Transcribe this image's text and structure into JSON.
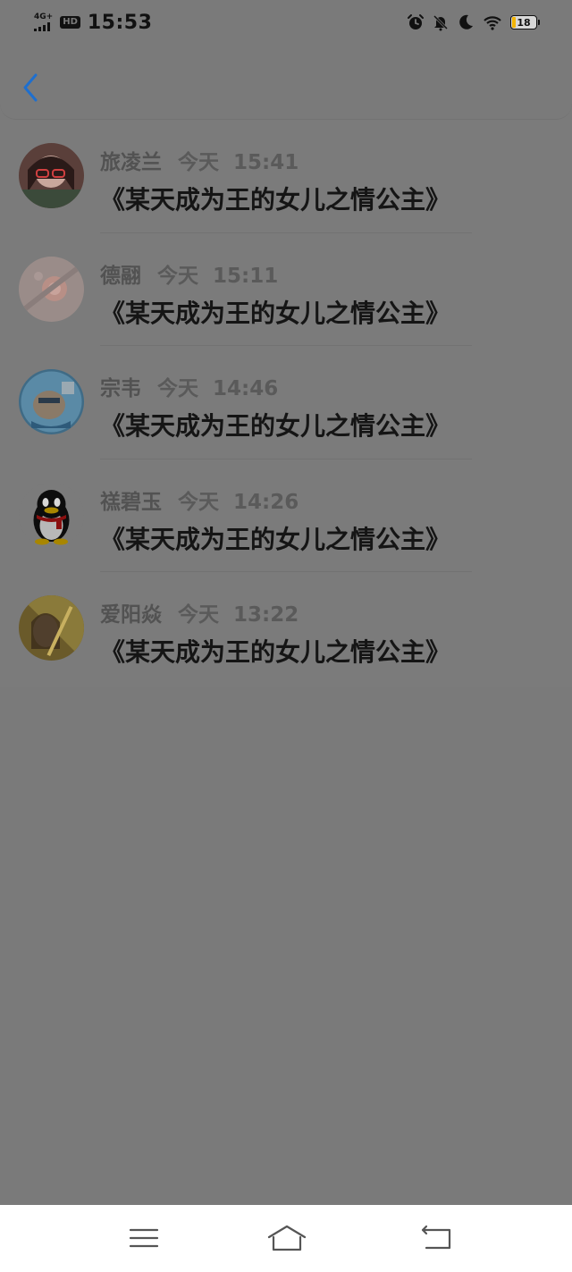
{
  "status_bar": {
    "network": "4G+",
    "hd": "HD",
    "time": "15:53",
    "battery": "18",
    "icons": [
      "alarm-icon",
      "mute-icon",
      "moon-icon",
      "wifi-icon",
      "battery-icon"
    ]
  },
  "header": {
    "back_icon": "chevron-left-icon",
    "accent_color": "#1e6fcf"
  },
  "messages": [
    {
      "name": "旅凌兰",
      "day": "今天",
      "time": "15:41",
      "text": "《某天成为王的女儿之情公主》"
    },
    {
      "name": "德翮",
      "day": "今天",
      "time": "15:11",
      "text": "《某天成为王的女儿之情公主》"
    },
    {
      "name": "宗韦",
      "day": "今天",
      "time": "14:46",
      "text": "《某天成为王的女儿之情公主》"
    },
    {
      "name": "禚碧玉",
      "day": "今天",
      "time": "14:26",
      "text": "《某天成为王的女儿之情公主》"
    },
    {
      "name": "爱阳焱",
      "day": "今天",
      "time": "13:22",
      "text": "《某天成为王的女儿之情公主》"
    }
  ],
  "navbar": {
    "icons": [
      "menu-icon",
      "home-icon",
      "back-icon"
    ]
  }
}
